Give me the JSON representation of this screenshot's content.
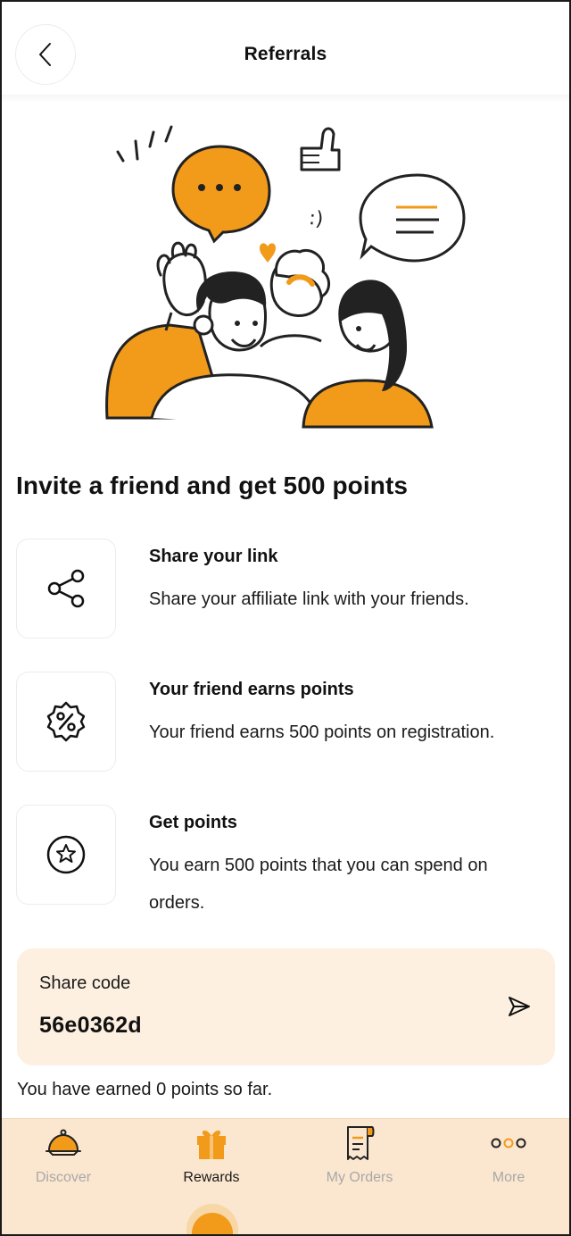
{
  "header": {
    "title": "Referrals"
  },
  "headline": "Invite a friend and get 500 points",
  "steps": [
    {
      "title": "Share your link",
      "description": "Share your affiliate link with your friends.",
      "icon": "share-icon"
    },
    {
      "title": "Your friend earns points",
      "description": "Your friend earns 500 points on registration.",
      "icon": "percent-badge-icon"
    },
    {
      "title": "Get points",
      "description": "You earn 500 points that you can spend on orders.",
      "icon": "star-circle-icon"
    }
  ],
  "share": {
    "label": "Share code",
    "code": "56e0362d",
    "send_icon": "send-icon"
  },
  "earned_text": "You have earned 0 points so far.",
  "nav": {
    "items": [
      {
        "label": "Discover",
        "icon": "cloche-icon",
        "active": false
      },
      {
        "label": "Rewards",
        "icon": "gift-icon",
        "active": true
      },
      {
        "label": "My Orders",
        "icon": "receipt-icon",
        "active": false
      },
      {
        "label": "More",
        "icon": "more-dots-icon",
        "active": false
      }
    ]
  },
  "colors": {
    "accent": "#f29a1a",
    "card_bg": "#fdf0e0",
    "nav_bg": "#fbe7cf",
    "inactive_text": "#a8a8a8"
  }
}
